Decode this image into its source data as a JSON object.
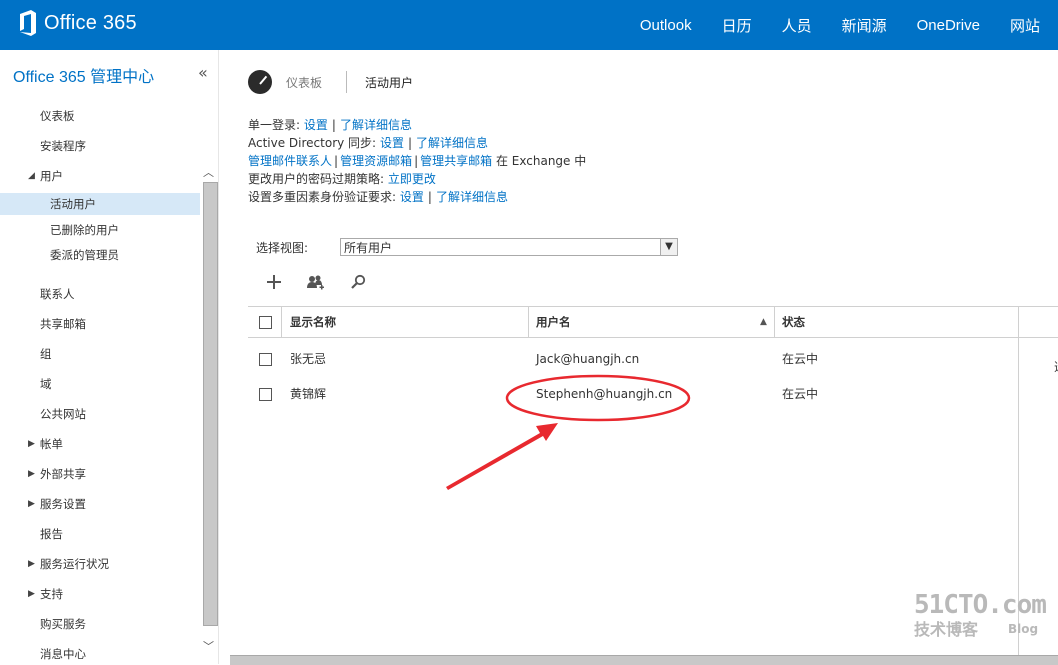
{
  "topbar": {
    "logo_text": "Office 365",
    "nav": [
      "Outlook",
      "日历",
      "人员",
      "新闻源",
      "OneDrive",
      "网站"
    ]
  },
  "sidebar": {
    "title": "Office 365 管理中心",
    "collapse": "«",
    "items": [
      {
        "label": "仪表板",
        "indent": 1,
        "tri": ""
      },
      {
        "label": "安装程序",
        "indent": 1,
        "tri": ""
      },
      {
        "label": "用户",
        "indent": 1,
        "tri": "◢"
      },
      {
        "label": "活动用户",
        "indent": 2,
        "tri": "",
        "active": true
      },
      {
        "label": "已删除的用户",
        "indent": 2,
        "tri": ""
      },
      {
        "label": "委派的管理员",
        "indent": 2,
        "tri": ""
      },
      {
        "label": "联系人",
        "indent": 1,
        "tri": ""
      },
      {
        "label": "共享邮箱",
        "indent": 1,
        "tri": ""
      },
      {
        "label": "组",
        "indent": 1,
        "tri": ""
      },
      {
        "label": "域",
        "indent": 1,
        "tri": ""
      },
      {
        "label": "公共网站",
        "indent": 1,
        "tri": ""
      },
      {
        "label": "帐单",
        "indent": 1,
        "tri": "▶"
      },
      {
        "label": "外部共享",
        "indent": 1,
        "tri": "▶"
      },
      {
        "label": "服务设置",
        "indent": 1,
        "tri": "▶"
      },
      {
        "label": "报告",
        "indent": 1,
        "tri": ""
      },
      {
        "label": "服务运行状况",
        "indent": 1,
        "tri": "▶"
      },
      {
        "label": "支持",
        "indent": 1,
        "tri": "▶"
      },
      {
        "label": "购买服务",
        "indent": 1,
        "tri": ""
      },
      {
        "label": "消息中心",
        "indent": 1,
        "tri": ""
      }
    ]
  },
  "breadcrumb": {
    "parent": "仪表板",
    "current": "活动用户"
  },
  "info": {
    "sso_label": "单一登录:",
    "sso_setup": "设置",
    "sso_learn": "了解详细信息",
    "ad_label": "Active Directory 同步:",
    "ad_setup": "设置",
    "ad_learn": "了解详细信息",
    "ex_contacts": "管理邮件联系人",
    "ex_resources": "管理资源邮箱",
    "ex_shared": "管理共享邮箱",
    "ex_suffix": "在 Exchange 中",
    "pwd_label": "更改用户的密码过期策略:",
    "pwd_link": "立即更改",
    "mfa_label": "设置多重因素身份验证要求:",
    "mfa_setup": "设置",
    "mfa_learn": "了解详细信息"
  },
  "view": {
    "label": "选择视图:",
    "value": "所有用户"
  },
  "table": {
    "headers": {
      "name": "显示名称",
      "user": "用户名",
      "status": "状态"
    },
    "rows": [
      {
        "name": "张无忌",
        "user": "Jack@huangjh.cn",
        "status": "在云中"
      },
      {
        "name": "黄锦辉",
        "user": "Stephenh@huangjh.cn",
        "status": "在云中"
      }
    ],
    "edge_char": "选"
  },
  "watermark": {
    "line1": "51CTO.com",
    "line2": "技术博客",
    "line3": "Blog"
  },
  "colors": {
    "brand": "#0072c6",
    "annotation": "#e8292f"
  }
}
